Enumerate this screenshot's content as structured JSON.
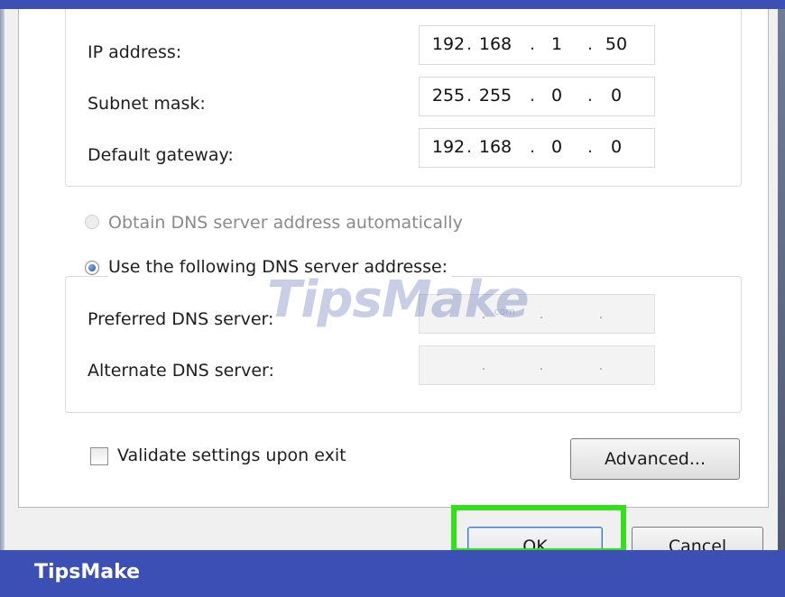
{
  "ip_settings": {
    "ip_address": {
      "label": "IP address:",
      "octets": [
        "192",
        "168",
        "1",
        "50"
      ]
    },
    "subnet_mask": {
      "label": "Subnet mask:",
      "octets": [
        "255",
        "255",
        "0",
        "0"
      ]
    },
    "default_gateway": {
      "label": "Default gateway:",
      "octets": [
        "192",
        "168",
        "0",
        "0"
      ]
    }
  },
  "dns": {
    "auto_label": "Obtain DNS server address automatically",
    "auto_selected": false,
    "auto_enabled": false,
    "manual_label": "Use the following DNS server addresse:",
    "manual_selected": true,
    "preferred": {
      "label": "Preferred DNS server:",
      "octets": [
        "",
        "",
        "",
        ""
      ]
    },
    "alternate": {
      "label": "Alternate DNS server:",
      "octets": [
        "",
        "",
        "",
        ""
      ]
    }
  },
  "validate": {
    "label": "Validate settings upon exit",
    "checked": false
  },
  "buttons": {
    "advanced": "Advanced...",
    "ok": "OK",
    "cancel": "Cancel"
  },
  "highlight_color": "#33e01b",
  "watermark": {
    "main": "TipsMake",
    "suffix": ".com"
  },
  "footer": {
    "brand": "TipsMake",
    "color": "#3c4fb4"
  }
}
